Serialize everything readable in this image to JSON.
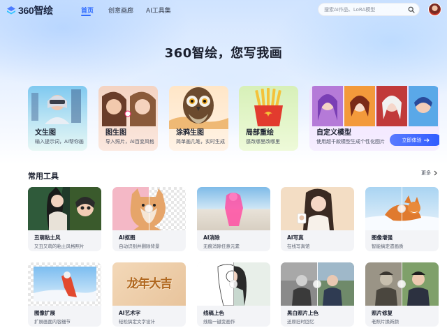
{
  "app": {
    "logo_text": "360智绘"
  },
  "nav": {
    "items": [
      {
        "label": "首页",
        "active": true
      },
      {
        "label": "创意画廊",
        "active": false
      },
      {
        "label": "AI工具集",
        "active": false
      }
    ],
    "search_placeholder": "搜索AI作品、LoRA模型",
    "search_icon": "search-icon",
    "accent_color": "#2f6bff"
  },
  "hero": {
    "title": "360智绘，您写我画"
  },
  "features": [
    {
      "label": "文生图",
      "desc": "输入提示词，AI帮你画"
    },
    {
      "label": "图生图",
      "desc": "导入照片，AI百变风格"
    },
    {
      "label": "涂鸦生图",
      "desc": "简单画几笔，实时生成"
    },
    {
      "label": "局部重绘",
      "desc": "感改哪里改哪里"
    },
    {
      "label": "自定义模型",
      "desc": "使用超千款模型生成个性化图片",
      "button": "立即体验"
    }
  ],
  "tools_section": {
    "title": "常用工具",
    "more": "更多"
  },
  "tools": [
    {
      "name": "丑萌粘土风",
      "desc": "又丑又萌的粘土风格照片"
    },
    {
      "name": "AI抠图",
      "desc": "自动识别并删除背景"
    },
    {
      "name": "AI消除",
      "desc": "无痕消除任意元素"
    },
    {
      "name": "AI写真",
      "desc": "在线写真馆"
    },
    {
      "name": "图像增强",
      "desc": "智能搞定遗画质"
    },
    {
      "name": "图像扩展",
      "desc": "扩展画面内容细节"
    },
    {
      "name": "AI艺术字",
      "desc": "轻松搞定文字设计"
    },
    {
      "name": "线稿上色",
      "desc": "线稿一键变画作"
    },
    {
      "name": "黑白照片上色",
      "desc": "还原旧时回忆"
    },
    {
      "name": "照片修复",
      "desc": "老照片换新颜"
    }
  ],
  "art_text": {
    "calligraphy": "龙年大吉"
  }
}
